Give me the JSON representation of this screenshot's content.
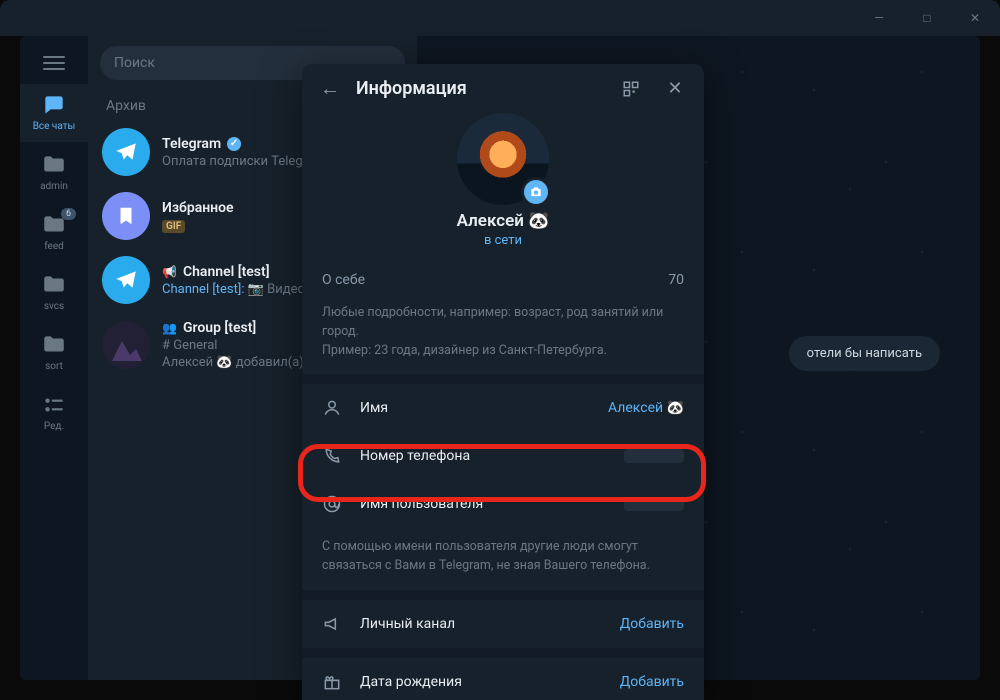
{
  "titlebar": {
    "min": "—",
    "max": "□",
    "close": "✕"
  },
  "rail": {
    "items": [
      {
        "label": "Все чаты",
        "icon": "chats"
      },
      {
        "label": "admin",
        "icon": "folder"
      },
      {
        "label": "feed",
        "icon": "folder",
        "badge": "6"
      },
      {
        "label": "svcs",
        "icon": "folder"
      },
      {
        "label": "sort",
        "icon": "folder"
      },
      {
        "label": "Ред.",
        "icon": "edit"
      }
    ]
  },
  "search": {
    "placeholder": "Поиск"
  },
  "sections": {
    "archive": "Архив"
  },
  "chats": [
    {
      "title": "Telegram",
      "verified": true,
      "sub": "Оплата подписки Telegr…",
      "avatar": "tg"
    },
    {
      "title": "Избранное",
      "sub_badge": "GIF",
      "avatar": "saved"
    },
    {
      "title": "Channel [test]",
      "muted": true,
      "sub_prefix": "Channel [test]:",
      "sub_rest": " 📷 Видес…",
      "avatar": "tg"
    },
    {
      "title": "Group [test]",
      "muted": true,
      "topic": "# General",
      "sub": "Алексей 🐼 добавил(а) С…",
      "avatar": "img",
      "group_icon": true
    }
  ],
  "main": {
    "placeholder_tail": "отели бы написать"
  },
  "panel": {
    "title": "Информация",
    "profile": {
      "name": "Алексей 🐼",
      "status": "в сети"
    },
    "bio": {
      "label": "О себе",
      "count": "70"
    },
    "bio_hint": "Любые подробности, например: возраст, род занятий или город.\nПример: 23 года, дизайнер из Санкт-Петербурга.",
    "rows": {
      "name": {
        "label": "Имя",
        "value": "Алексей 🐼"
      },
      "phone": {
        "label": "Номер телефона"
      },
      "username": {
        "label": "Имя пользователя"
      }
    },
    "username_hint": "С помощью имени пользователя другие люди смогут связаться с Вами в Telegram, не зная Вашего телефона.",
    "channel": {
      "label": "Личный канал",
      "action": "Добавить"
    },
    "birthday": {
      "label": "Дата рождения",
      "action": "Добавить"
    }
  }
}
